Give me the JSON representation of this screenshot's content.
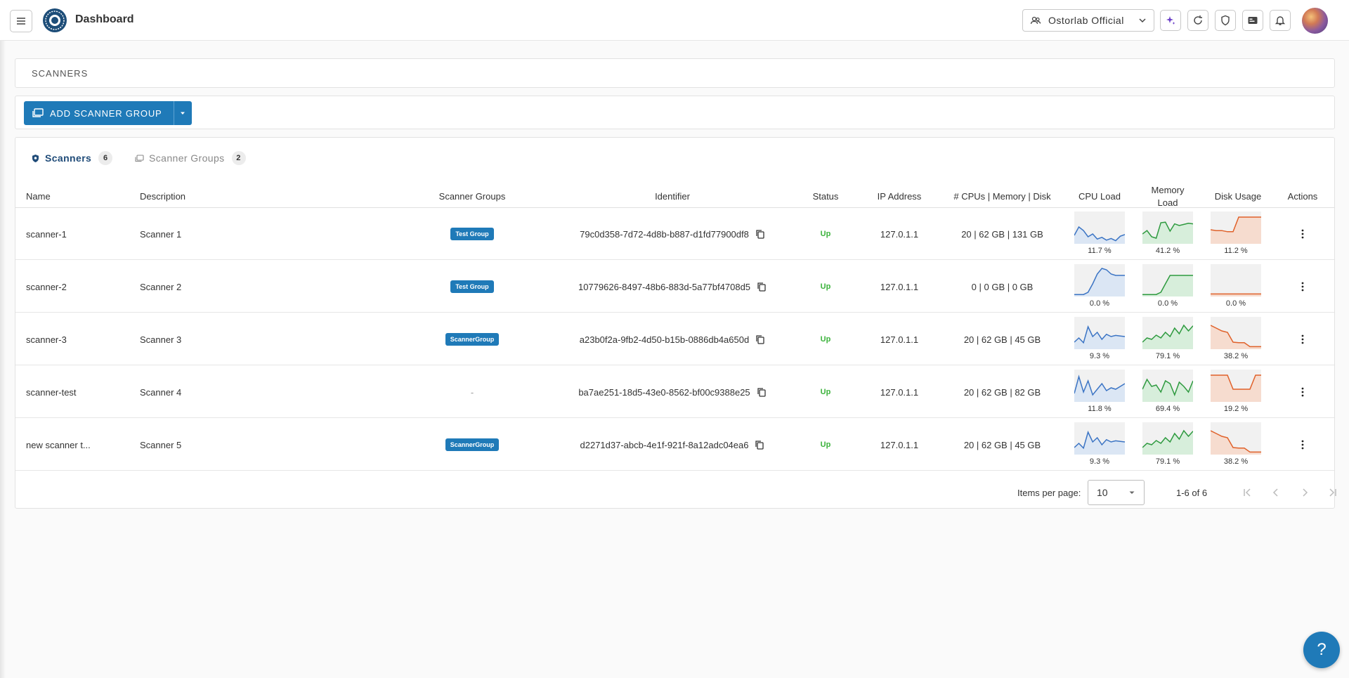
{
  "header": {
    "title": "Dashboard",
    "org": "Ostorlab Official"
  },
  "breadcrumb": "SCANNERS",
  "toolbar": {
    "add_label": "ADD SCANNER GROUP"
  },
  "tabs": [
    {
      "label": "Scanners",
      "count": "6"
    },
    {
      "label": "Scanner Groups",
      "count": "2"
    }
  ],
  "columns": {
    "name": "Name",
    "description": "Description",
    "groups": "Scanner Groups",
    "identifier": "Identifier",
    "status": "Status",
    "ip": "IP Address",
    "resources": "# CPUs | Memory | Disk",
    "cpu": "CPU Load",
    "memory": "Memory Load",
    "disk": "Disk Usage",
    "actions": "Actions"
  },
  "rows": [
    {
      "name": "scanner-1",
      "description": "Scanner 1",
      "group": "Test Group",
      "identifier": "79c0d358-7d72-4d8b-b887-d1fd77900df8",
      "status": "Up",
      "ip": "127.0.1.1",
      "resources": "20 | 62 GB | 131 GB",
      "cpu": {
        "pct": "11.7 %",
        "series": [
          25,
          55,
          42,
          20,
          30,
          12,
          18,
          8,
          14,
          6,
          22,
          28
        ]
      },
      "mem": {
        "pct": "41.2 %",
        "series": [
          30,
          42,
          20,
          15,
          70,
          72,
          40,
          66,
          60,
          64,
          68,
          66
        ]
      },
      "disk": {
        "pct": "11.2 %",
        "series": [
          45,
          42,
          42,
          38,
          38,
          90,
          90,
          90,
          90,
          90
        ]
      }
    },
    {
      "name": "scanner-2",
      "description": "Scanner 2",
      "group": "Test Group",
      "identifier": "10779626-8497-48b6-883d-5a77bf4708d5",
      "status": "Up",
      "ip": "127.0.1.1",
      "resources": "0 | 0 GB | 0 GB",
      "cpu": {
        "pct": "0.0 %",
        "series": [
          2,
          2,
          2,
          10,
          40,
          75,
          95,
          90,
          75,
          70,
          70,
          70
        ]
      },
      "mem": {
        "pct": "0.0 %",
        "series": [
          2,
          2,
          2,
          2,
          10,
          40,
          70,
          70,
          70,
          70,
          70,
          70
        ]
      },
      "disk": {
        "pct": "0.0 %",
        "series": [
          4,
          4,
          4,
          4,
          4,
          4,
          4,
          4,
          4,
          4
        ]
      }
    },
    {
      "name": "scanner-3",
      "description": "Scanner 3",
      "group": "ScannerGroup",
      "identifier": "a23b0f2a-9fb2-4d50-b15b-0886db4a650d",
      "status": "Up",
      "ip": "127.0.1.1",
      "resources": "20 | 62 GB | 45 GB",
      "cpu": {
        "pct": "9.3 %",
        "series": [
          20,
          35,
          18,
          75,
          40,
          55,
          30,
          48,
          40,
          44,
          42,
          40
        ]
      },
      "mem": {
        "pct": "79.1 %",
        "series": [
          20,
          35,
          30,
          45,
          35,
          55,
          40,
          70,
          50,
          80,
          60,
          78
        ]
      },
      "disk": {
        "pct": "38.2 %",
        "series": [
          80,
          70,
          60,
          55,
          20,
          18,
          18,
          4,
          4,
          4
        ]
      }
    },
    {
      "name": "scanner-test",
      "description": "Scanner 4",
      "group": "",
      "identifier": "ba7ae251-18d5-43e0-8562-bf00c9388e25",
      "status": "Up",
      "ip": "127.0.1.1",
      "resources": "20 | 62 GB | 82 GB",
      "cpu": {
        "pct": "11.8 %",
        "series": [
          25,
          85,
          30,
          70,
          20,
          40,
          60,
          35,
          45,
          40,
          50,
          60
        ]
      },
      "mem": {
        "pct": "69.4 %",
        "series": [
          40,
          75,
          50,
          55,
          30,
          70,
          60,
          20,
          65,
          50,
          30,
          70
        ]
      },
      "disk": {
        "pct": "19.2 %",
        "series": [
          90,
          90,
          90,
          90,
          40,
          40,
          40,
          40,
          90,
          90
        ]
      }
    },
    {
      "name": "new scanner t...",
      "description": "Scanner 5",
      "group": "ScannerGroup",
      "identifier": "d2271d37-abcb-4e1f-921f-8a12adc04ea6",
      "status": "Up",
      "ip": "127.0.1.1",
      "resources": "20 | 62 GB | 45 GB",
      "cpu": {
        "pct": "9.3 %",
        "series": [
          20,
          35,
          18,
          75,
          40,
          55,
          30,
          48,
          40,
          44,
          42,
          40
        ]
      },
      "mem": {
        "pct": "79.1 %",
        "series": [
          20,
          35,
          30,
          45,
          35,
          55,
          40,
          70,
          50,
          80,
          60,
          78
        ]
      },
      "disk": {
        "pct": "38.2 %",
        "series": [
          80,
          70,
          60,
          55,
          20,
          18,
          18,
          4,
          4,
          4
        ]
      }
    }
  ],
  "pagination": {
    "label": "Items per page:",
    "per_page": "10",
    "range": "1-6 of 6"
  },
  "help": "?",
  "colors": {
    "primary": "#1f7ab8",
    "cpu": "#3b74c4",
    "cpu_fill": "#dbe6f4",
    "mem": "#2e9a3f",
    "mem_fill": "#d7eedb",
    "disk": "#e0612a",
    "disk_fill": "#f6dccf",
    "status_up": "#3cb33c"
  }
}
